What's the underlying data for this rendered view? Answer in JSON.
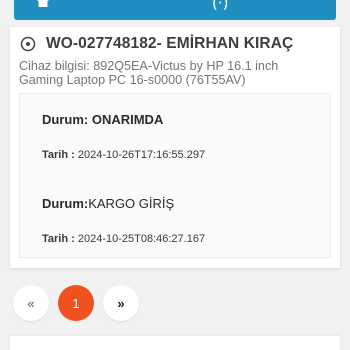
{
  "header": {
    "partial_text": "(·)"
  },
  "work_order": {
    "title": "WO-027748182- EMİRHAN KIRAÇ",
    "device_line1": "Cihaz bilgisi: 892Q5EA-Victus by HP 16.1 inch",
    "device_line2": "Gaming Laptop PC 16-s0000 (76T55AV)"
  },
  "history": [
    {
      "status_label": "Durum: ",
      "status_value": "ONARIMDA",
      "date_label": "Tarih : ",
      "date_value": "2024-10-26T17:16:55.297"
    },
    {
      "status_label": "Durum:",
      "status_value": "KARGO GİRİŞ",
      "date_label": "Tarih : ",
      "date_value": "2024-10-25T08:46:27.167"
    }
  ],
  "pagination": {
    "prev": "«",
    "current": "1",
    "next": "»"
  },
  "colors": {
    "header": "#1f8fc2",
    "active_page": "#f0511f"
  },
  "icons": {
    "header": "home-icon",
    "title": "clock-icon"
  }
}
